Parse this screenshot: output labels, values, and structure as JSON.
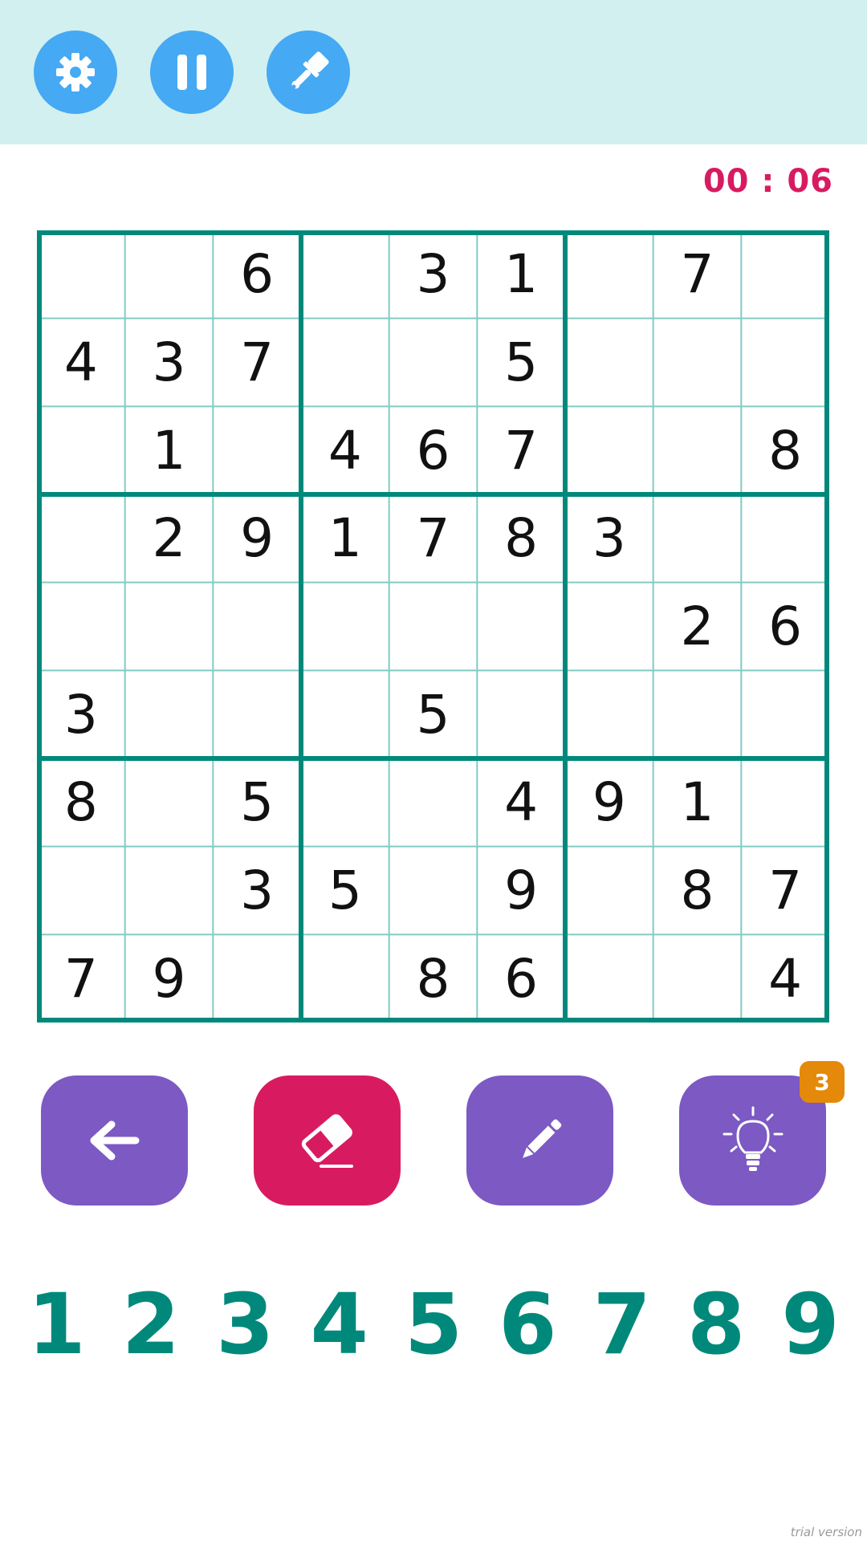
{
  "header": {
    "buttons": [
      {
        "name": "settings",
        "icon": "gear-icon"
      },
      {
        "name": "pause",
        "icon": "pause-icon"
      },
      {
        "name": "theme",
        "icon": "paint-brush-icon"
      }
    ]
  },
  "timer": "00 : 06",
  "board": {
    "cells": [
      [
        "",
        "",
        "6",
        "",
        "3",
        "1",
        "",
        "7",
        ""
      ],
      [
        "4",
        "3",
        "7",
        "",
        "",
        "5",
        "",
        "",
        ""
      ],
      [
        "",
        "1",
        "",
        "4",
        "6",
        "7",
        "",
        "",
        "8"
      ],
      [
        "",
        "2",
        "9",
        "1",
        "7",
        "8",
        "3",
        "",
        ""
      ],
      [
        "",
        "",
        "",
        "",
        "",
        "",
        "",
        "2",
        "6"
      ],
      [
        "3",
        "",
        "",
        "",
        "5",
        "",
        "",
        "",
        ""
      ],
      [
        "8",
        "",
        "5",
        "",
        "",
        "4",
        "9",
        "1",
        ""
      ],
      [
        "",
        "",
        "3",
        "5",
        "",
        "9",
        "",
        "8",
        "7"
      ],
      [
        "7",
        "9",
        "",
        "",
        "8",
        "6",
        "",
        "",
        "4"
      ]
    ]
  },
  "actions": {
    "undo_icon": "arrow-left-icon",
    "erase_icon": "eraser-icon",
    "notes_icon": "pencil-icon",
    "hint_icon": "lightbulb-icon",
    "hint_count": "3"
  },
  "numpad": [
    "1",
    "2",
    "3",
    "4",
    "5",
    "6",
    "7",
    "8",
    "9"
  ],
  "watermark": "trial version",
  "colors": {
    "header_bg": "#d2f0ef",
    "circle_button": "#45a9f3",
    "grid_major": "#00897b",
    "grid_minor": "#80cbc4",
    "timer": "#d81b60",
    "action_purple": "#7c59c3",
    "action_erase": "#d81b60",
    "hint_badge": "#e5890a",
    "numpad": "#00897b"
  }
}
